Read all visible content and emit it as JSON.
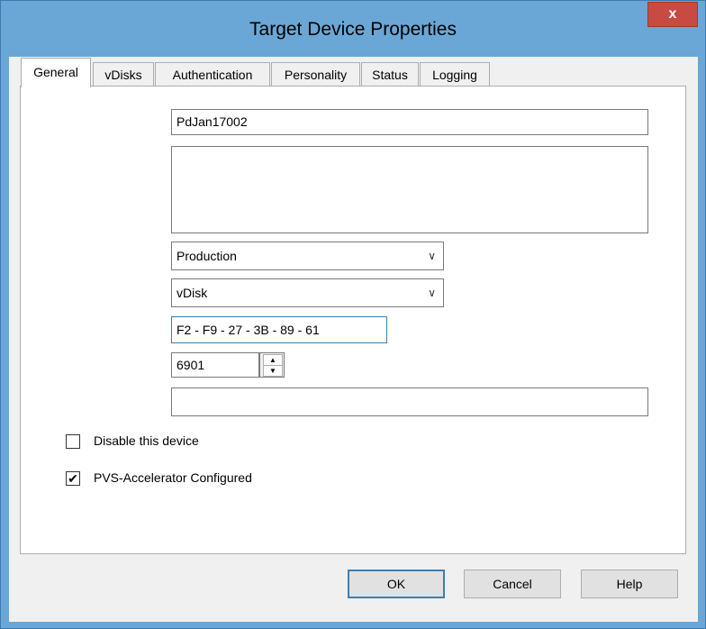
{
  "window": {
    "title": "Target Device Properties",
    "close_label": "x"
  },
  "tabs": [
    {
      "label": "General",
      "active": true
    },
    {
      "label": "vDisks"
    },
    {
      "label": "Authentication"
    },
    {
      "label": "Personality"
    },
    {
      "label": "Status"
    },
    {
      "label": "Logging"
    }
  ],
  "general": {
    "name": "PdJan17002",
    "description": "",
    "type_selected": "Production",
    "boot_from_selected": "vDisk",
    "mac": "F2 - F9 - 27 - 3B - 89 - 61",
    "port": "6901",
    "class": ""
  },
  "checkboxes": {
    "disable_device": {
      "label": "Disable this device",
      "checked": false
    },
    "pvs_accelerator": {
      "label": "PVS-Accelerator Configured",
      "checked": true
    }
  },
  "buttons": {
    "ok": "OK",
    "cancel": "Cancel",
    "help": "Help"
  },
  "icons": {
    "check": "✔",
    "chevron": "∨",
    "spin_up": "▲",
    "spin_down": "▼"
  },
  "colors": {
    "frame": "#6aa7d6",
    "close": "#c74a43",
    "default_button_border": "#3c7fb1"
  }
}
